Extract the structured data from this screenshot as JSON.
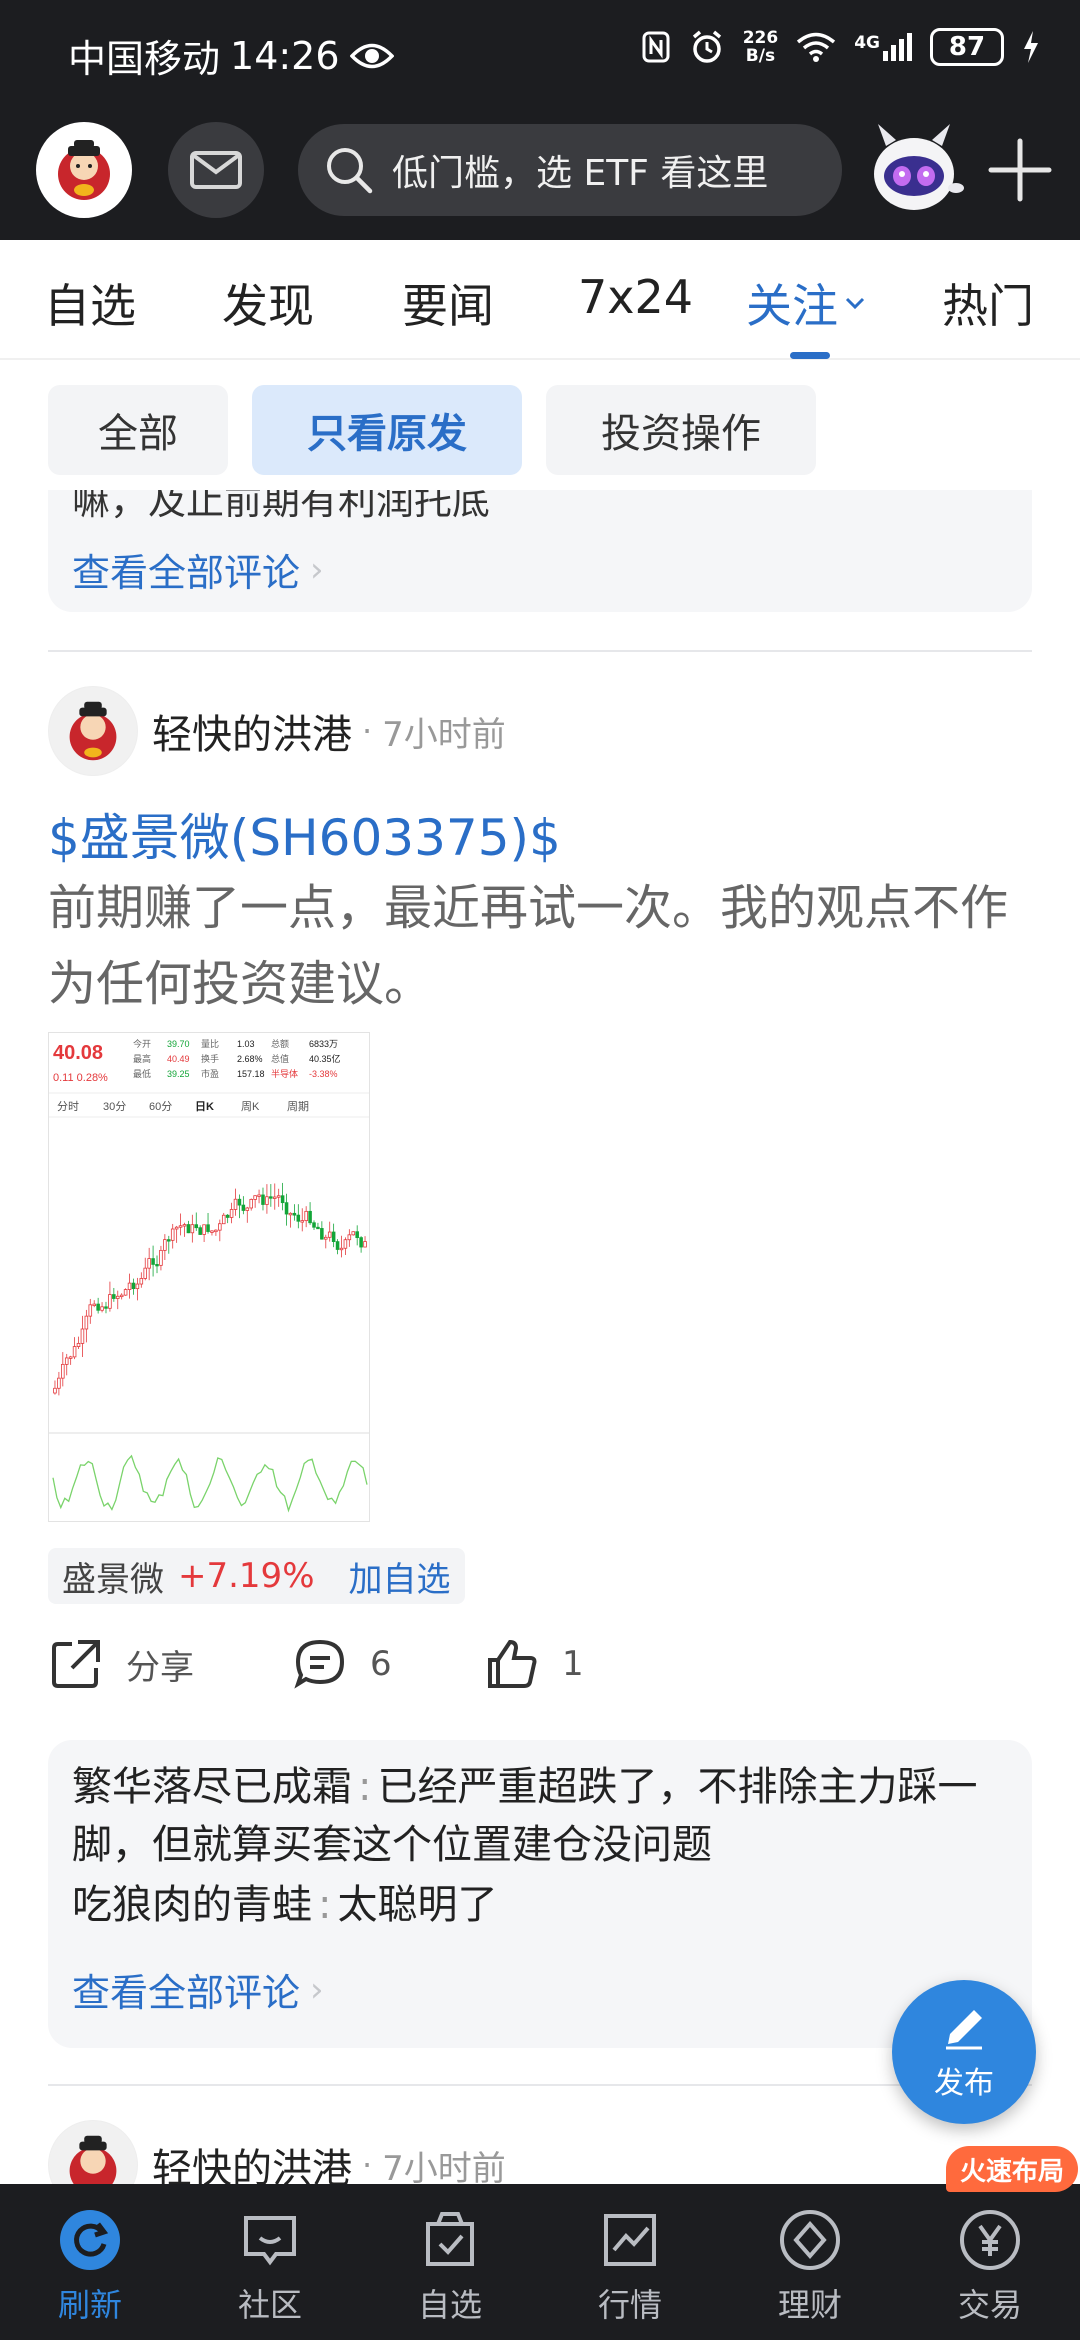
{
  "status_bar": {
    "carrier": "中国移动",
    "time": "14:26",
    "net_speed_value": "226",
    "net_speed_unit": "B/s",
    "network": "4G",
    "battery": "87"
  },
  "header": {
    "search_placeholder": "低门槛，选 ETF 看这里"
  },
  "tabs": [
    {
      "label": "自选"
    },
    {
      "label": "发现"
    },
    {
      "label": "要闻"
    },
    {
      "label": "7x24"
    },
    {
      "label": "关注"
    },
    {
      "label": "热门"
    }
  ],
  "filter_chips": [
    {
      "label": "全部"
    },
    {
      "label": "只看原发"
    },
    {
      "label": "投资操作"
    }
  ],
  "prev_card": {
    "cut_text": "嘛，及止前期有利润托底",
    "view_all": "查看全部评论"
  },
  "post": {
    "author": "轻快的洪港",
    "time": "7小时前",
    "stock_tag": "$盛景微(SH603375)$",
    "text": "前期赚了一点，最近再试一次。我的观点不作为任何投资建议。",
    "image": {
      "price": "40.08",
      "change": "0.11 0.28%",
      "rows": [
        [
          "今开",
          "39.70",
          "量比",
          "1.03",
          "总额",
          "6833万"
        ],
        [
          "最高",
          "40.49",
          "换手",
          "2.68%",
          "总值",
          "40.35亿"
        ],
        [
          "最低",
          "39.25",
          "市盈",
          "157.18",
          "半导体",
          "-3.38%"
        ]
      ],
      "periods": [
        "分时",
        "30分",
        "60分",
        "日K",
        "周K",
        "周期"
      ]
    },
    "stock_pill": {
      "name": "盛景微",
      "change": "+7.19%",
      "add": "加自选"
    },
    "actions": {
      "share": "分享",
      "comments": "6",
      "likes": "1"
    },
    "comments": [
      {
        "user": "繁华落尽已成霜",
        "text": "已经严重超跌了，不排除主力踩一脚，但就算买套这个位置建仓没问题"
      },
      {
        "user": "吃狼肉的青蛙",
        "text": "太聪明了"
      }
    ],
    "view_all": "查看全部评论"
  },
  "next_post": {
    "author": "轻快的洪港",
    "time": "7小时前"
  },
  "fab_label": "发布",
  "promo_badge": "火速布局",
  "bottom_nav": [
    {
      "label": "刷新",
      "icon": "refresh-icon"
    },
    {
      "label": "社区",
      "icon": "chat-icon"
    },
    {
      "label": "自选",
      "icon": "bag-check-icon"
    },
    {
      "label": "行情",
      "icon": "chart-icon"
    },
    {
      "label": "理财",
      "icon": "diamond-icon"
    },
    {
      "label": "交易",
      "icon": "yen-icon"
    }
  ],
  "colors": {
    "accent": "#2a6ec7",
    "rise": "#e4393c",
    "dark_bg": "#1c1d20"
  }
}
